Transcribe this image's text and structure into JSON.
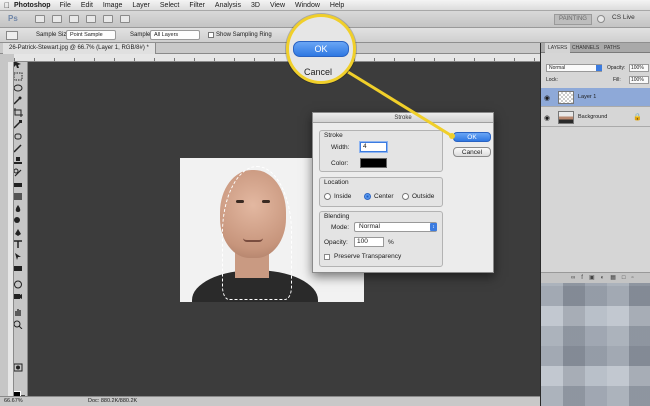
{
  "menubar": {
    "apple": "",
    "app": "Photoshop",
    "items": [
      "File",
      "Edit",
      "Image",
      "Layer",
      "Select",
      "Filter",
      "Analysis",
      "3D",
      "View",
      "Window",
      "Help"
    ]
  },
  "appbar": {
    "logo": "Ps",
    "workspace": "PAINTING",
    "cs_live": "CS Live"
  },
  "options": {
    "sample_size_label": "Sample Size:",
    "sample_size_value": "Point Sample",
    "sample_label": "Sample:",
    "sample_value": "All Layers",
    "ring_label": "Show Sampling Ring"
  },
  "document": {
    "tab_title": "26-Patrick-Stewart.jpg @ 66.7% (Layer 1, RGB/8#) *",
    "zoom": "66.67%",
    "doc_info": "Doc: 880.2K/880.2K"
  },
  "panel": {
    "tabs": [
      "LAYERS",
      "CHANNELS",
      "PATHS"
    ],
    "blend_mode": "Normal",
    "opacity_label": "Opacity:",
    "opacity_value": "100%",
    "lock_label": "Lock:",
    "fill_label": "Fill:",
    "fill_value": "100%",
    "layers": [
      {
        "name": "Layer 1",
        "selected": true
      },
      {
        "name": "Background",
        "selected": false
      }
    ]
  },
  "dialog": {
    "title": "Stroke",
    "stroke_group": "Stroke",
    "width_label": "Width:",
    "width_value": "4",
    "color_label": "Color:",
    "color_value": "#000000",
    "location_group": "Location",
    "location_options": [
      "Inside",
      "Center",
      "Outside"
    ],
    "location_selected": "Center",
    "blending_group": "Blending",
    "mode_label": "Mode:",
    "mode_value": "Normal",
    "opacity_label": "Opacity:",
    "opacity_value": "100",
    "opacity_unit": "%",
    "preserve_label": "Preserve Transparency",
    "ok_label": "OK",
    "cancel_label": "Cancel"
  },
  "callout": {
    "ok_label": "OK",
    "cancel_label": "Cancel",
    "accent": "#f0cf2a"
  }
}
